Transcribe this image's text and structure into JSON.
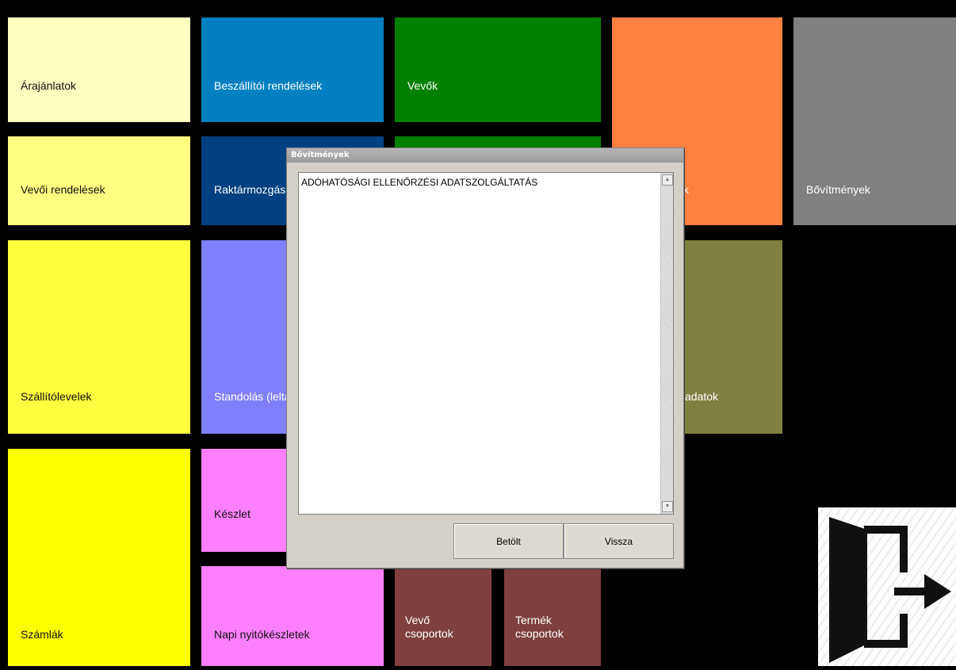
{
  "tiles": {
    "arajanlatok": "Árajánlatok",
    "beszallitoi_rendelesek": "Beszállítói rendelések",
    "vevok": "Vevők",
    "bovitmenyek": "Bővítmények",
    "vevoi_rendelesek": "Vevői rendelések",
    "raktarmozgas": "Raktármozgás",
    "orange_partial": "k",
    "szallitolevelek": "Szállítólevelek",
    "standolas": "Standolás (leltár)",
    "olive_partial": "adatok",
    "keszlet": "Készlet",
    "szamlak": "Számlák",
    "napi_nyitokeszletek": "Napi nyitókészletek",
    "vevo_csoportok": [
      "Vevő",
      "csoportok"
    ],
    "termek_csoportok": [
      "Termék",
      "csoportok"
    ]
  },
  "dialog": {
    "title": "Bővítmények",
    "items": [
      "ADÓHATÓSÁGI ELLENŐRZÉSI ADATSZOLGÁLTATÁS"
    ],
    "load_button": "Betölt",
    "back_button": "Vissza"
  },
  "icons": {
    "exit": "exit-door-icon",
    "scroll_up": "scroll-up-arrow-icon",
    "scroll_down": "scroll-down-arrow-icon"
  },
  "colors": {
    "arajanlatok": "#ffffc0",
    "beszallitoi": "#0080c0",
    "vevok": "#008000",
    "orange": "#ff8040",
    "gray": "#808080",
    "vevoi_rendelesek": "#ffff80",
    "raktarmozgas": "#004080",
    "yellow": "#ffff40",
    "lavender": "#8080ff",
    "olive": "#808040",
    "pink": "#ff80ff",
    "bright_yellow": "#ffff00",
    "maroon": "#804040"
  }
}
